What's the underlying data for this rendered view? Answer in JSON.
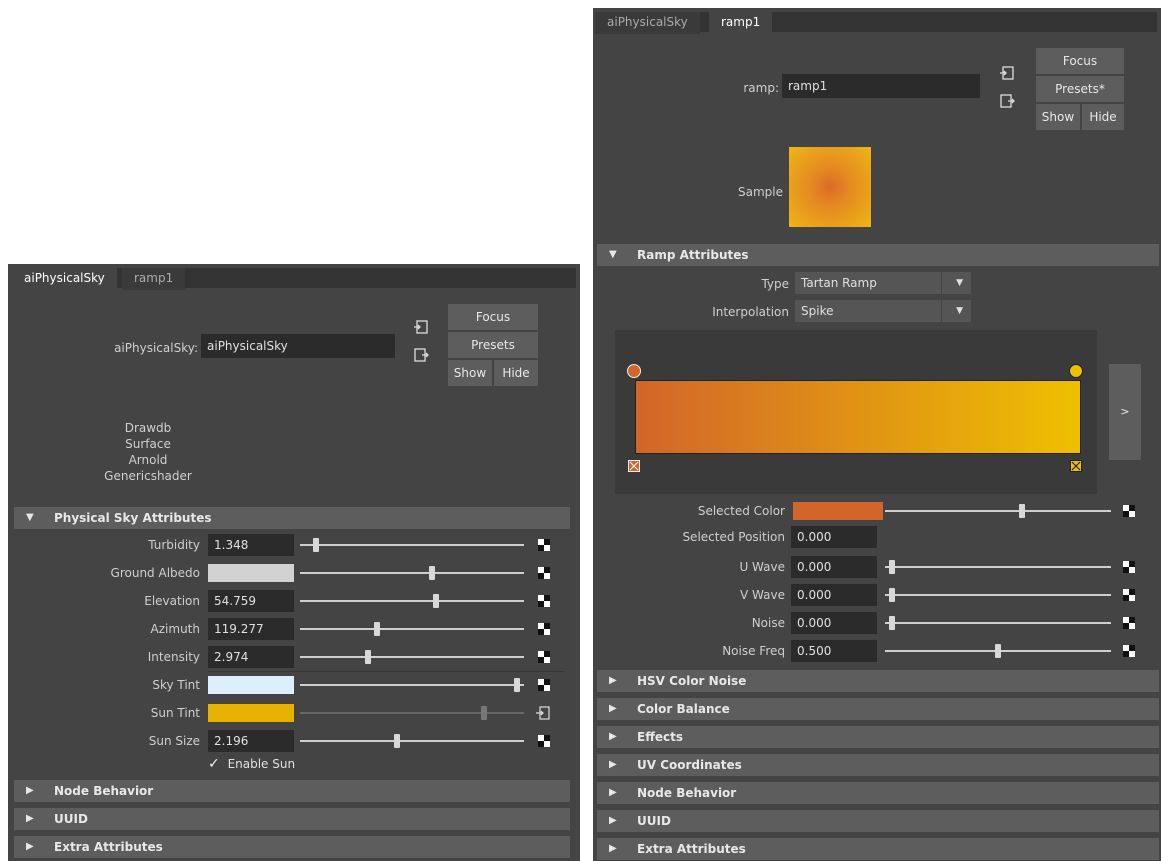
{
  "left": {
    "tabs": [
      "aiPhysicalSky",
      "ramp1"
    ],
    "node_label": "aiPhysicalSky:",
    "node_name": "aiPhysicalSky",
    "buttons": {
      "focus": "Focus",
      "presets": "Presets",
      "show": "Show",
      "hide": "Hide"
    },
    "classification": [
      "Drawdb",
      "Surface",
      "Arnold",
      "Genericshader"
    ],
    "section_title": "Physical Sky Attributes",
    "attrs": [
      {
        "label": "Turbidity",
        "value": "1.348",
        "slider": 0.06
      },
      {
        "label": "Ground Albedo",
        "color": "#d2d2d2",
        "slider": 0.59
      },
      {
        "label": "Elevation",
        "value": "54.759",
        "slider": 0.61
      },
      {
        "label": "Azimuth",
        "value": "119.277",
        "slider": 0.34
      },
      {
        "label": "Intensity",
        "value": "2.974",
        "slider": 0.3
      },
      {
        "label": "Sky Tint",
        "color": "#ddeeff",
        "slider": 0.98
      },
      {
        "label": "Sun Tint",
        "color": "#e8b300",
        "slider": 0.83
      },
      {
        "label": "Sun Size",
        "value": "2.196",
        "slider": 0.43
      }
    ],
    "enable_sun": "Enable Sun",
    "collapsed": [
      "Node Behavior",
      "UUID",
      "Extra Attributes"
    ]
  },
  "right": {
    "tabs": [
      "aiPhysicalSky",
      "ramp1"
    ],
    "node_label": "ramp:",
    "node_name": "ramp1",
    "buttons": {
      "focus": "Focus",
      "presets": "Presets*",
      "show": "Show",
      "hide": "Hide"
    },
    "sample_label": "Sample",
    "section_title": "Ramp Attributes",
    "type_label": "Type",
    "type_value": "Tartan Ramp",
    "interp_label": "Interpolation",
    "interp_value": "Spike",
    "ramp_colors": {
      "start": "#d2652a",
      "end": "#eec000"
    },
    "expand_btn": ">",
    "attrs": [
      {
        "label": "Selected Color",
        "color": "#d2652a",
        "slider": 0.61
      },
      {
        "label": "Selected Position",
        "value": "0.000"
      },
      {
        "label": "U Wave",
        "value": "0.000",
        "slider": 0.02
      },
      {
        "label": "V Wave",
        "value": "0.000",
        "slider": 0.02
      },
      {
        "label": "Noise",
        "value": "0.000",
        "slider": 0.02
      },
      {
        "label": "Noise Freq",
        "value": "0.500",
        "slider": 0.5
      }
    ],
    "collapsed": [
      "HSV Color Noise",
      "Color Balance",
      "Effects",
      "UV Coordinates",
      "Node Behavior",
      "UUID",
      "Extra Attributes"
    ]
  }
}
